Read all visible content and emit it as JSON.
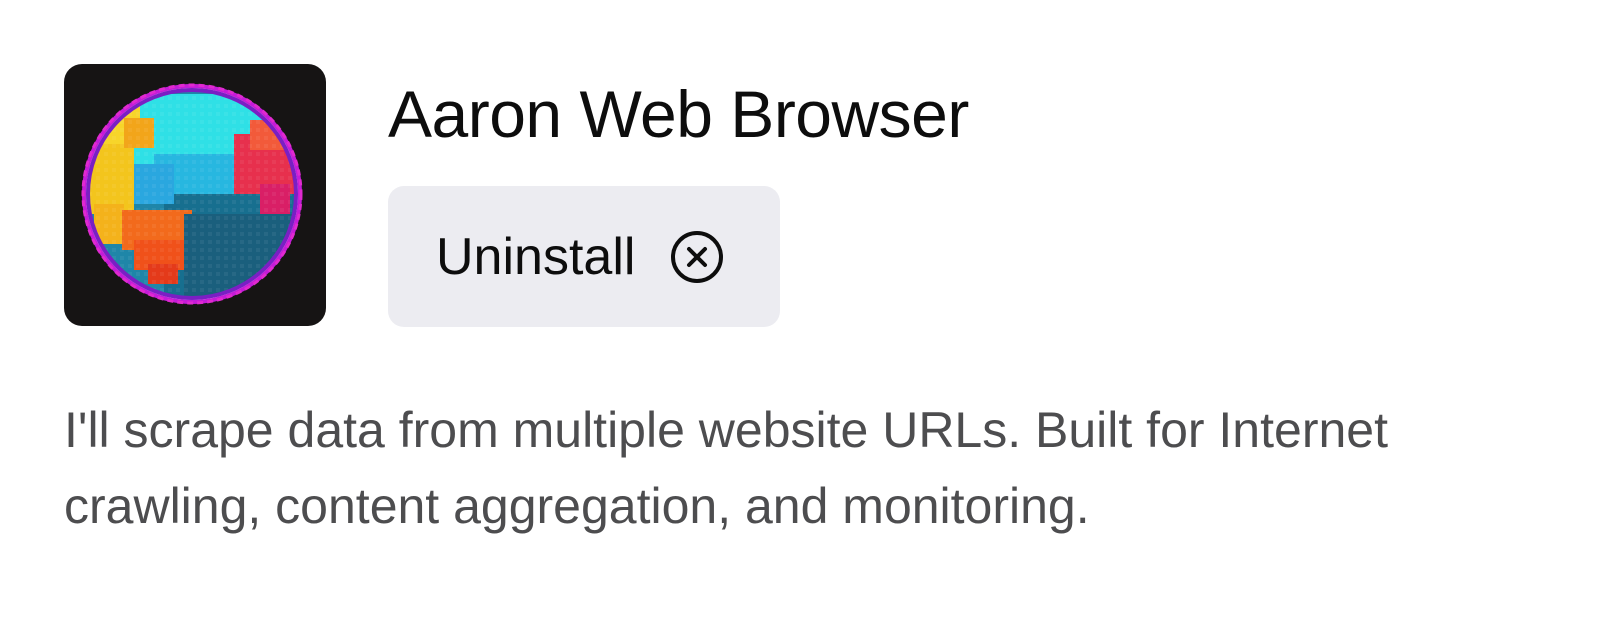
{
  "plugin": {
    "name": "Aaron Web Browser",
    "logo_icon": "pixel-globe-icon",
    "description": "I'll scrape data from multiple website URLs. Built for Internet crawling, content aggregation, and monitoring."
  },
  "actions": {
    "uninstall_label": "Uninstall",
    "uninstall_icon": "circle-x-icon"
  },
  "colors": {
    "button_bg": "#ececf1",
    "title_text": "#0d0d0d",
    "description_text": "#4d4d4f",
    "logo_bg": "#161414"
  }
}
